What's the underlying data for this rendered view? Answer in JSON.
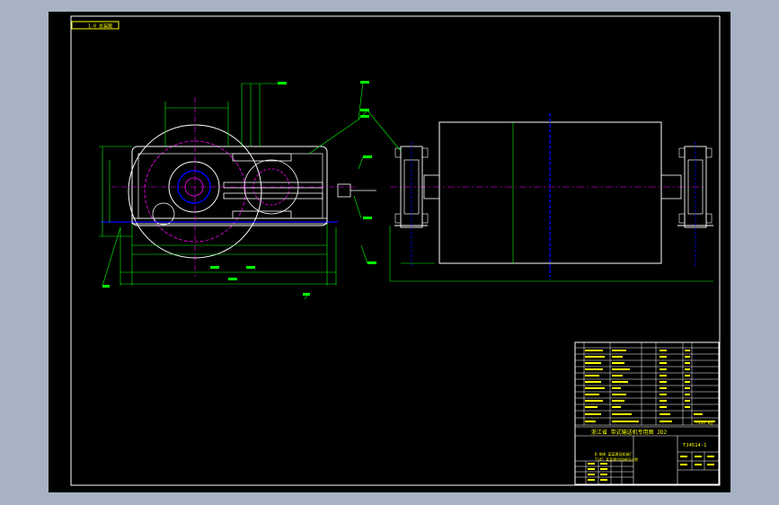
{
  "drawing": {
    "sheet_tag": "1-0 总装图",
    "title_line": "浙江省 带式输送机专用图 JD2",
    "drawing_number": "TJ4514-1",
    "company_lines": [
      "D-000 某某建设机械厂",
      "TJ45 某某建设机械设计院"
    ],
    "weight_text": "~349 kg",
    "colors": {
      "frame": "#ffffff",
      "drum": "#ffffff",
      "title_block": "#ffff00",
      "dimension": "#00ff00",
      "center_line": "#ff00ff",
      "axis": "#0000ff",
      "accent_yellow": "#ffff00"
    },
    "icons": {
      "sheet_tag_icon": "label-box"
    }
  }
}
